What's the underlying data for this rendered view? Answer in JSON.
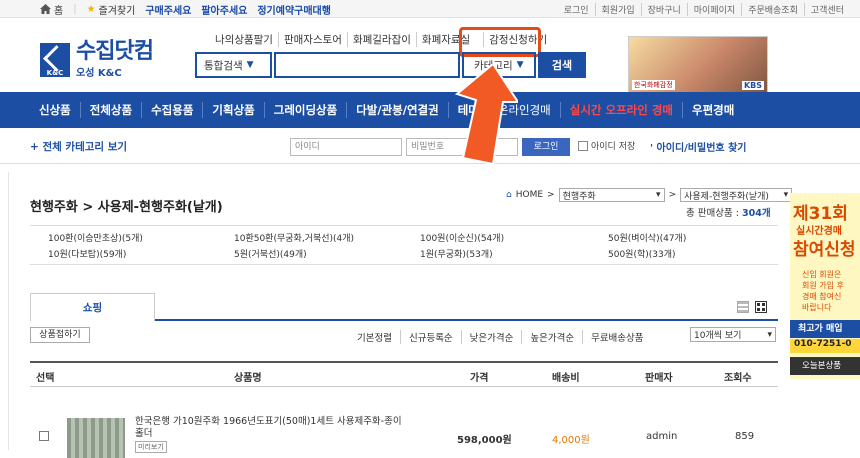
{
  "topbar": {
    "home": "홈",
    "bookmark": "즐겨찾기",
    "links": [
      "구매주세요",
      "팔아주세요",
      "정기예약구매대행"
    ],
    "right": [
      "로그인",
      "회원가입",
      "장바구니",
      "마이페이지",
      "주문배송조회",
      "고객센터"
    ]
  },
  "logo": {
    "name": "수집닷컴",
    "sub": "오성 K&C",
    "mark": "K&C"
  },
  "quick": [
    "나의상품팔기",
    "판매자스토어",
    "화폐길라잡이",
    "화폐자료실",
    "감정신청하기"
  ],
  "search": {
    "scope": "통합검색",
    "category": "카테고리",
    "button": "검색"
  },
  "banner": {
    "caption": "한국화폐감정",
    "broadcaster": "KBS"
  },
  "nav": [
    "신상품",
    "전체상품",
    "수집용품",
    "기획상품",
    "그레이딩상품",
    "다발/관봉/연결권",
    "테마",
    "온라인경매",
    "실시간 오프라인 경매",
    "우편경매"
  ],
  "subbar": {
    "all_categories": "+ 전체 카테고리 보기",
    "id_placeholder": "아이디",
    "pw_placeholder": "비밀번호",
    "login": "로그인",
    "save_id": "아이디 저장",
    "find": "' 아이디/비밀번호 찾기"
  },
  "page": {
    "breadcrumb": "현행주화 > 사용제-현행주화(낱개)",
    "home_label": "HOME",
    "dd1": "현행주화",
    "dd2": "사용제-현행주화(낱개)",
    "total_label": "총 판매상품 :",
    "total_count": "304개"
  },
  "categories": [
    [
      "100환(이승만초상)(5개)",
      "10환50환(무궁화,거북선)(4개)",
      "100원(이순신)(54개)",
      "50원(벼이삭)(47개)"
    ],
    [
      "10원(다보탑)(59개)",
      "5원(거북선)(49개)",
      "1원(무궁화)(53개)",
      "500원(학)(33개)"
    ]
  ],
  "tab": "쇼핑",
  "fold": "상품접하기",
  "sorts": [
    "기본정렬",
    "신규등록순",
    "낮은가격순",
    "높은가격순",
    "무료배송상품"
  ],
  "view_select": "10개씩 보기",
  "table": {
    "headers": [
      "선택",
      "상품명",
      "가격",
      "배송비",
      "판매자",
      "조회수"
    ],
    "rows": [
      {
        "name": "한국은행 가10원주화 1966년도표기(50매)1세트 사용제주화-종이홀더",
        "tag": "미리보기",
        "price": "598,000원",
        "ship": "4,000원",
        "seller": "admin",
        "views": "859"
      }
    ]
  },
  "side": {
    "l1": "제31회",
    "l2": "실시간경매",
    "l3": "참여신청",
    "l4": [
      "신입 회원은",
      "회원 가입 후",
      "경매 참여신",
      "바랍니다"
    ],
    "l5": "최고가 매입",
    "l6": "010-7251-0",
    "l7": "오늘본상품"
  },
  "colors": {
    "brand": "#1c4fa4",
    "highlight": "#e64a19",
    "accent_red": "#ff4747"
  }
}
